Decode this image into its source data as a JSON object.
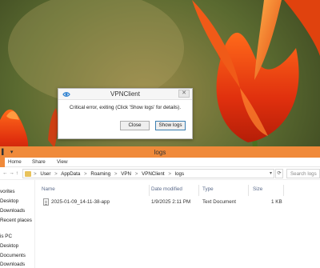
{
  "dialog": {
    "title": "VPNClient",
    "close_glyph": "✕",
    "message": "Critical error, exiting (Click 'Show logs' for details).",
    "close_button": "Close",
    "show_logs_button": "Show logs"
  },
  "explorer": {
    "title": "logs",
    "quick_access": "▌ ▾",
    "ribbon": {
      "tabs": [
        "Home",
        "Share",
        "View"
      ]
    },
    "nav_buttons": "← → ↑",
    "address": {
      "crumbs": [
        "User",
        "AppData",
        "Roaming",
        "VPN",
        "VPNClient",
        "logs"
      ],
      "separator": ">"
    },
    "refresh_glyph": "⟳",
    "search_placeholder": "Search logs",
    "nav_pane": [
      "vorites",
      "Desktop",
      "Downloads",
      "Recent places",
      "is PC",
      "Desktop",
      "Documents",
      "Downloads"
    ],
    "columns": {
      "name": "Name",
      "date": "Date modified",
      "type": "Type",
      "size": "Size"
    },
    "files": [
      {
        "name": "2025-01-09_14-11-38-app",
        "date": "1/9/2025 2:11 PM",
        "type": "Text Document",
        "size": "1 KB"
      }
    ]
  },
  "colors": {
    "explorer_accent": "#f08a3a",
    "button_focus": "#3c7fb1"
  }
}
